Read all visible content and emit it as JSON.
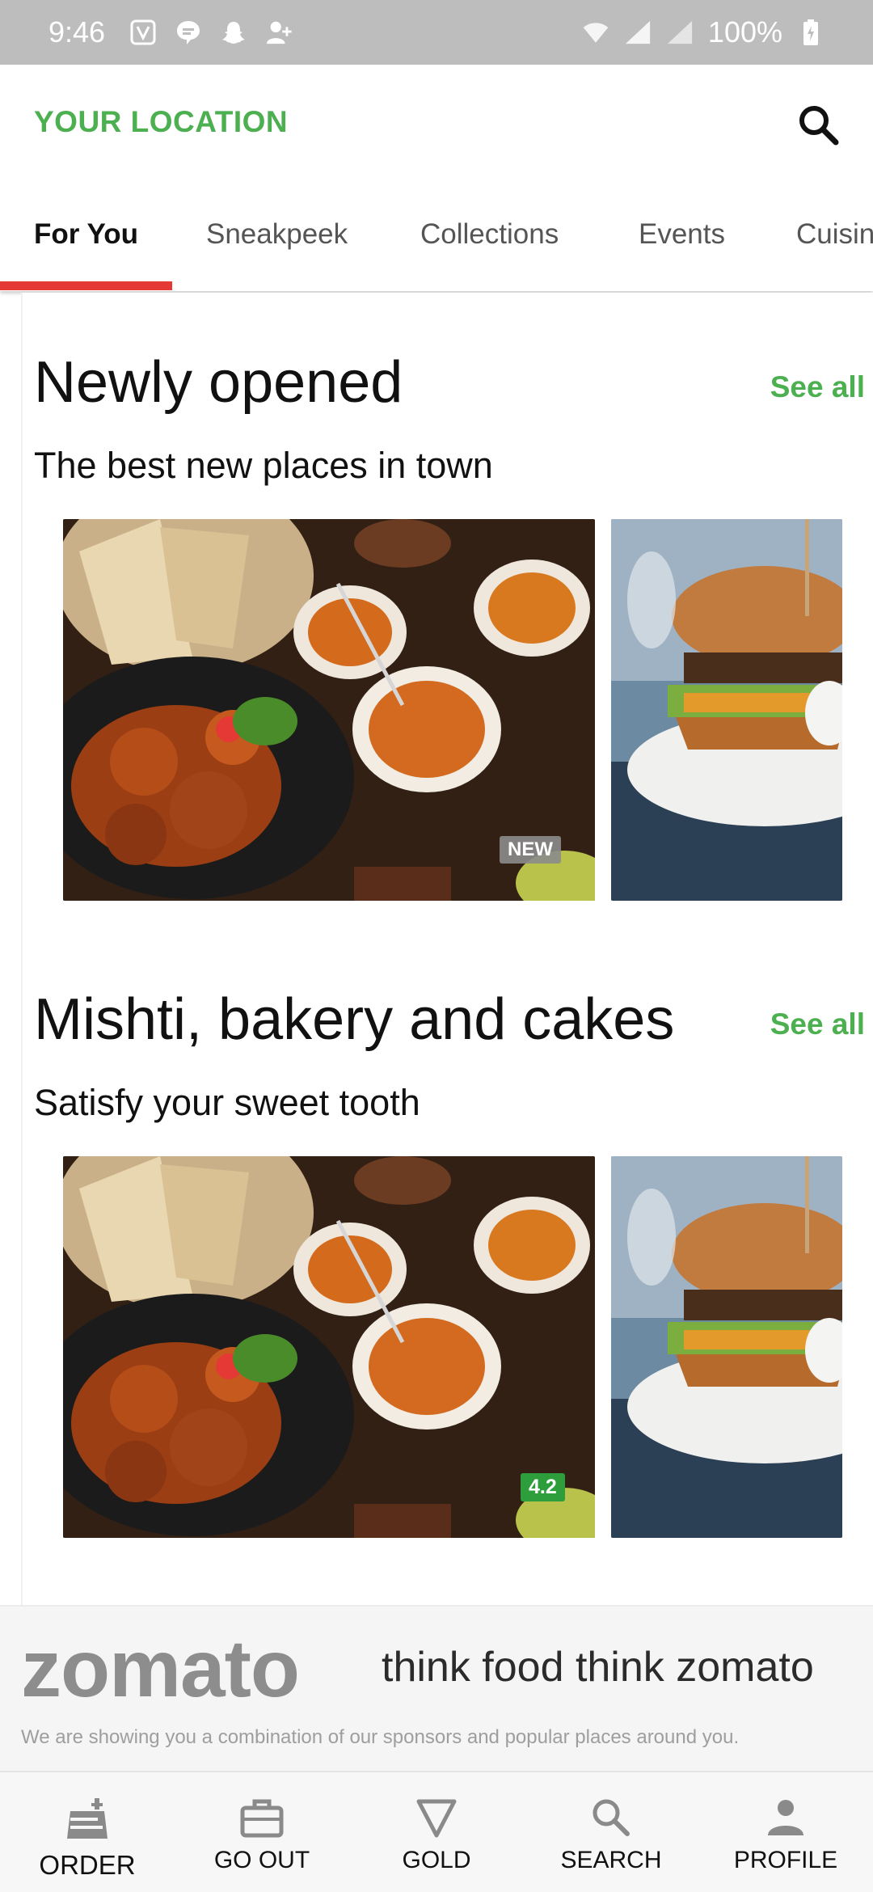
{
  "status_bar": {
    "time": "9:46",
    "battery": "100%"
  },
  "header": {
    "location_label": "YOUR LOCATION"
  },
  "tabs": [
    {
      "label": "For You"
    },
    {
      "label": "Sneakpeek"
    },
    {
      "label": "Collections"
    },
    {
      "label": "Events"
    },
    {
      "label": "Cuisin"
    }
  ],
  "sections": [
    {
      "title": "Newly opened",
      "subtitle": "The best new places in town",
      "see_all": "See all",
      "badge": "NEW"
    },
    {
      "title": "Mishti, bakery and cakes",
      "subtitle": "Satisfy your sweet tooth",
      "see_all": "See all",
      "badge": "4.2"
    }
  ],
  "footer": {
    "brand": "zomato",
    "tagline": "think food think zomato",
    "disclaimer": "We are showing you a combination of our sponsors and popular places around you."
  },
  "bottom_nav": [
    {
      "label": "ORDER",
      "icon": "order-icon"
    },
    {
      "label": "GO OUT",
      "icon": "briefcase-icon"
    },
    {
      "label": "GOLD",
      "icon": "gold-triangle-icon"
    },
    {
      "label": "SEARCH",
      "icon": "search-icon"
    },
    {
      "label": "PROFILE",
      "icon": "profile-icon"
    }
  ],
  "colors": {
    "accent_green": "#4caf50",
    "tab_underline": "#e53935",
    "rating_badge": "#2e9e3d"
  }
}
